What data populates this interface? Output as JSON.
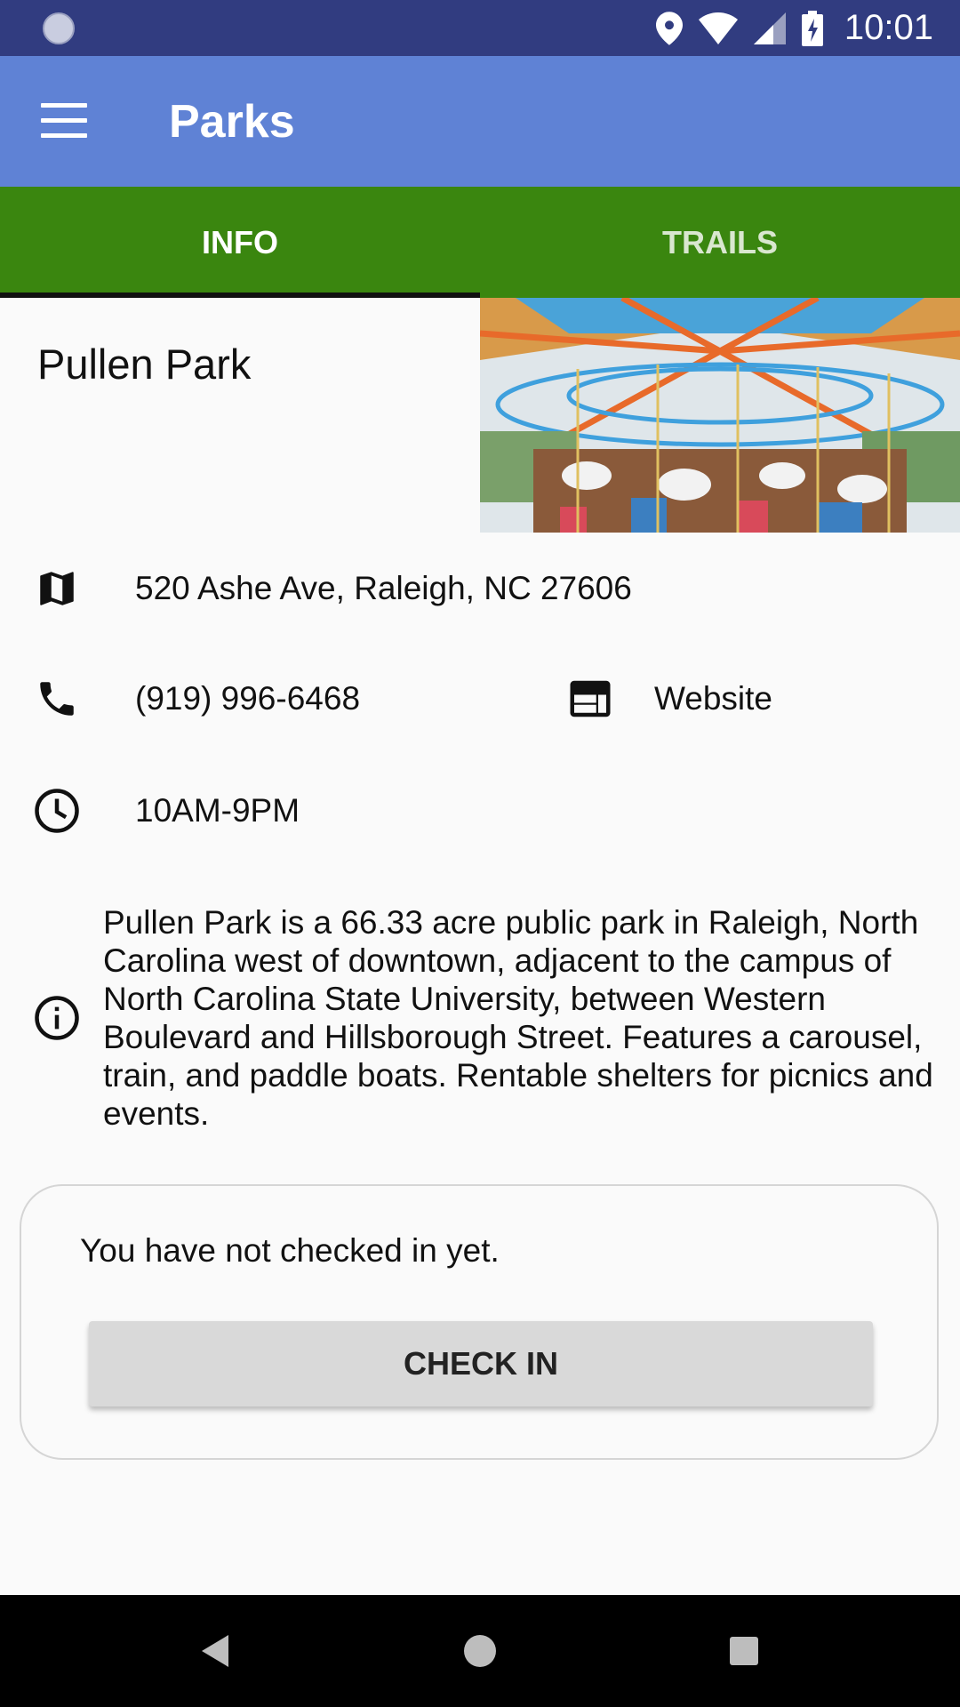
{
  "status_bar": {
    "time": "10:01"
  },
  "app_bar": {
    "title": "Parks"
  },
  "tabs": [
    {
      "label": "INFO",
      "active": true
    },
    {
      "label": "TRAILS",
      "active": false
    }
  ],
  "park": {
    "name": "Pullen Park",
    "address": "520 Ashe Ave, Raleigh, NC 27606",
    "phone": "(919) 996-6468",
    "website_label": "Website",
    "hours": "10AM-9PM",
    "description": "Pullen Park is a 66.33 acre public park in Raleigh, North Carolina west of downtown, adjacent to the campus of North Carolina State University, between Western Boulevard and Hillsborough Street. Features a carousel, train, and paddle boats. Rentable shelters for picnics and events."
  },
  "checkin": {
    "status_text": "You have not checked in yet.",
    "button_label": "CHECK IN"
  },
  "icons": {
    "address": "map-icon",
    "phone": "phone-icon",
    "website": "web-icon",
    "hours": "clock-icon",
    "description": "info-icon"
  },
  "colors": {
    "status_bar": "#313c80",
    "app_bar": "#5f82d5",
    "tab_bar": "#3a860f",
    "tab_indicator": "#111111",
    "button_bg": "#d9d9d9"
  }
}
